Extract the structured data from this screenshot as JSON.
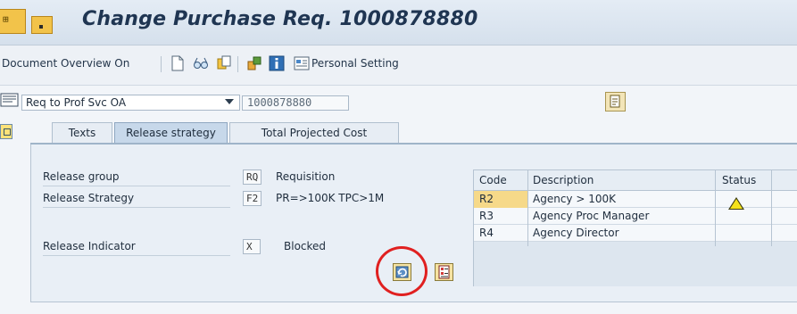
{
  "window": {
    "title": "Change Purchase Req. 1000878880"
  },
  "toolbar": {
    "document_overview": "Document Overview On",
    "personal_setting": "Personal Setting",
    "icons": [
      "new-document-icon",
      "glasses-icon",
      "copy-icon",
      "puzzle-icon",
      "info-icon",
      "personal-setting-icon"
    ]
  },
  "header": {
    "document_type": "Req to Prof Svc OA",
    "document_number": "1000878880"
  },
  "tabs": [
    {
      "label": "Texts",
      "active": false
    },
    {
      "label": "Release strategy",
      "active": true
    },
    {
      "label": "Total Projected Cost",
      "active": false
    }
  ],
  "release": {
    "group_label": "Release group",
    "group_code": "RQ",
    "group_text": "Requisition",
    "strategy_label": "Release Strategy",
    "strategy_code": "F2",
    "strategy_text": "PR=>100K TPC>1M",
    "indicator_label": "Release Indicator",
    "indicator_code": "X",
    "indicator_text": "Blocked"
  },
  "release_table": {
    "headers": {
      "code": "Code",
      "description": "Description",
      "status": "Status"
    },
    "rows": [
      {
        "code": "R2",
        "description": "Agency > 100K",
        "status_icon": "warning-triangle-icon"
      },
      {
        "code": "R3",
        "description": "Agency Proc Manager",
        "status_icon": ""
      },
      {
        "code": "R4",
        "description": "Agency Director",
        "status_icon": ""
      }
    ]
  },
  "colors": {
    "title": "#1f3552",
    "highlight_ring": "#e02020",
    "selected_code": "#f6d989",
    "active_tab": "#c7d8ea"
  }
}
